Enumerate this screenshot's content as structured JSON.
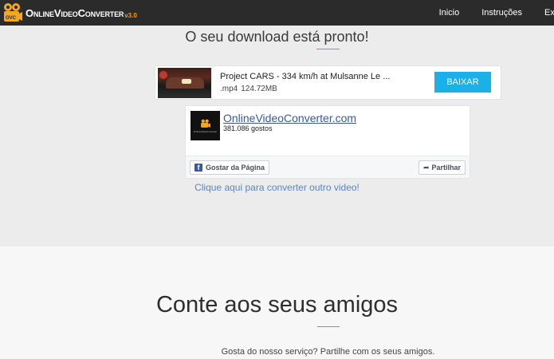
{
  "header": {
    "logo_badge": "OVC",
    "logo_first": "Online",
    "logo_second": "Video",
    "logo_third": "Converter",
    "logo_version": "v3.0",
    "nav": [
      "Inicio",
      "Instruções",
      "Extras"
    ]
  },
  "main": {
    "title": "O seu download está pronto!",
    "download": {
      "title": "Project CARS - 334 km/h at Mulsanne Le ...",
      "format": ".mp4",
      "size": "124.72MB",
      "button_label": "BAIXAR"
    },
    "facebook": {
      "page_name": "OnlineVideoConverter.com",
      "likes": "381.086 gostos",
      "avatar_caption": "OnlineVideoConverter",
      "like_button": "Gostar da Página",
      "share_button": "Partilhar"
    },
    "convert_again": "Clique aqui para converter outro video!"
  },
  "share_section": {
    "title": "Conte aos seus amigos",
    "subtitle": "Gosta do nosso serviço? Partilhe com os seus amigos."
  },
  "colors": {
    "header_bg": "#2b2b2b",
    "accent_orange": "#e07b39",
    "button_blue": "#1ab0e8",
    "facebook_blue": "#3b5998",
    "link_blue": "#5a86c0"
  }
}
